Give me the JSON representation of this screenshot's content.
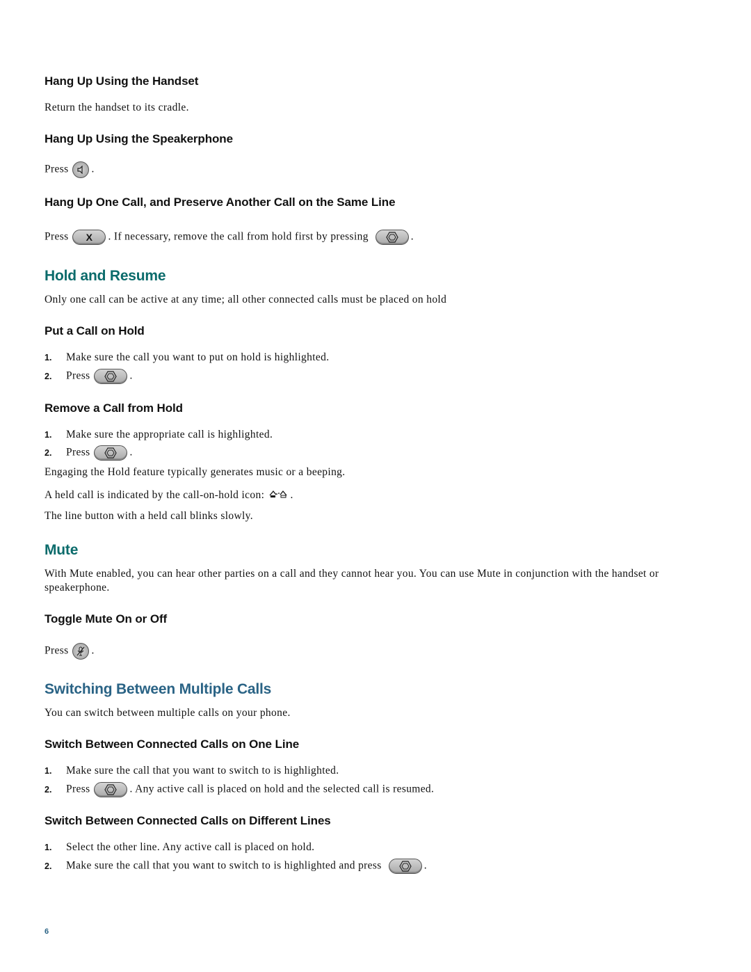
{
  "sections": {
    "hangup_handset": {
      "title": "Hang Up Using the Handset",
      "text": "Return the handset to its cradle."
    },
    "hangup_speaker": {
      "title": "Hang Up Using the Speakerphone",
      "press": "Press",
      "icon": "speaker-icon",
      "end": "."
    },
    "hangup_one": {
      "title": "Hang Up One Call, and Preserve Another Call on the Same Line",
      "press": "Press",
      "icon1": "end-call-x-icon",
      "icon1_label": "X",
      "mid": ". If necessary, remove the call from hold first by pressing",
      "icon2": "select-hexagon-icon",
      "end": "."
    },
    "hold_resume": {
      "title": "Hold and Resume",
      "text": "Only one call can be active at any time; all other connected calls must be placed on hold"
    },
    "put_on_hold": {
      "title": "Put a Call on Hold",
      "steps": [
        {
          "num": "1.",
          "text": "Make sure the call you want to put on hold is highlighted."
        },
        {
          "num": "2.",
          "text": "Press",
          "icon": "select-hexagon-icon",
          "end": "."
        }
      ]
    },
    "remove_from_hold": {
      "title": "Remove a Call from Hold",
      "steps": [
        {
          "num": "1.",
          "text": "Make sure the appropriate call is highlighted."
        },
        {
          "num": "2.",
          "text": "Press",
          "icon": "select-hexagon-icon",
          "end": "."
        }
      ],
      "note1": "Engaging the Hold feature typically generates music or a beeping.",
      "note2": "A held call is indicated by the call-on-hold icon:",
      "note2_icon": "call-on-hold-icon",
      "note2_end": ".",
      "note3": "The line button with a held call blinks slowly."
    },
    "mute": {
      "title": "Mute",
      "text": "With Mute enabled, you can hear other parties on a call and they cannot hear you. You can use Mute in conjunction with the handset or speakerphone."
    },
    "toggle_mute": {
      "title": "Toggle Mute On or Off",
      "press": "Press",
      "icon": "mute-microphone-icon",
      "end": "."
    },
    "switching": {
      "title": "Switching Between Multiple Calls",
      "text": "You can switch between multiple calls on your phone."
    },
    "switch_one_line": {
      "title": "Switch Between Connected Calls on One Line",
      "steps": [
        {
          "num": "1.",
          "text": "Make sure the call that you want to switch to is highlighted."
        },
        {
          "num": "2.",
          "text": "Press",
          "icon": "select-hexagon-icon",
          "end": ". Any active call is placed on hold and the selected call is resumed."
        }
      ]
    },
    "switch_diff_lines": {
      "title": "Switch Between Connected Calls on Different Lines",
      "steps": [
        {
          "num": "1.",
          "text": "Select the other line. Any active call is placed on hold."
        },
        {
          "num": "2.",
          "text": "Make sure the call that you want to switch to is highlighted and press",
          "icon": "select-hexagon-icon",
          "end": "."
        }
      ]
    }
  },
  "colors": {
    "heading_teal": "#0b6b6b",
    "heading_blue": "#2a6385"
  },
  "footer": {
    "page_number": "6"
  }
}
